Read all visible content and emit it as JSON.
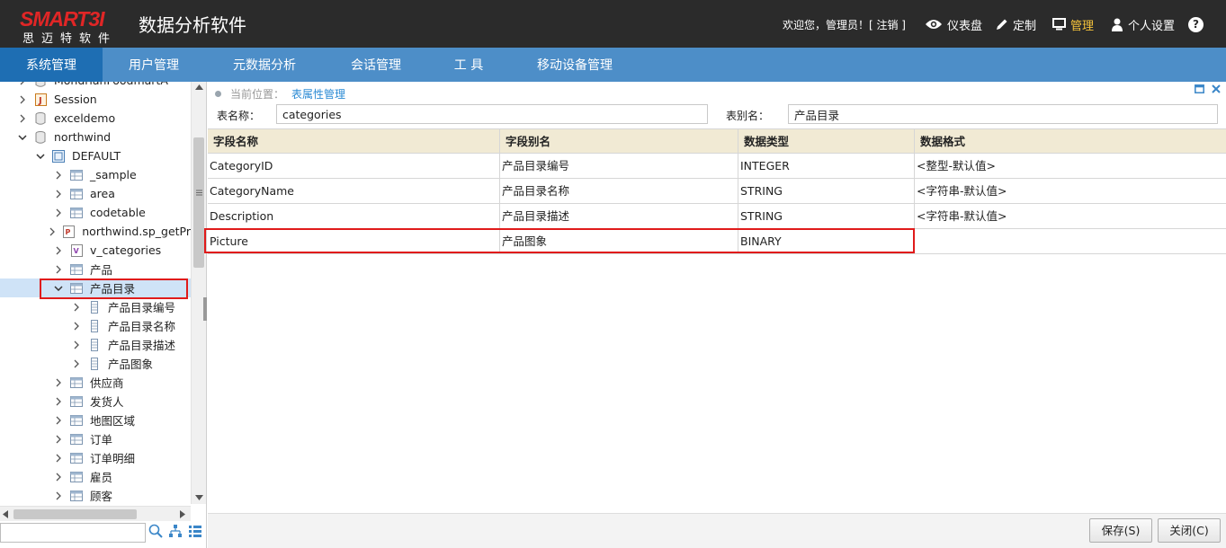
{
  "header": {
    "brand": "SMART3I",
    "brand_sub": "思迈特软件",
    "app_title": "数据分析软件",
    "welcome": "欢迎您，管理员！[ 注销 ]",
    "items": [
      {
        "label": "仪表盘",
        "icon": "eye-icon"
      },
      {
        "label": "定制",
        "icon": "pencil-icon"
      },
      {
        "label": "管理",
        "icon": "monitor-icon",
        "active": true
      },
      {
        "label": "个人设置",
        "icon": "user-icon"
      },
      {
        "label": "?",
        "icon": "help-icon"
      }
    ],
    "accent_color": "#f5c33b",
    "brand_color": "#e02626"
  },
  "nav": {
    "items": [
      "系统管理",
      "用户管理",
      "元数据分析",
      "会话管理",
      "工 具",
      "移动设备管理"
    ],
    "active_index": 0
  },
  "tree": {
    "rows": [
      {
        "label": "MondrianFoodmartA",
        "icon": "db-icon",
        "expanded": false
      },
      {
        "label": "Session",
        "icon": "java-icon",
        "expanded": false
      },
      {
        "label": "exceldemo",
        "icon": "db-icon",
        "expanded": false
      },
      {
        "label": "northwind",
        "icon": "db-icon",
        "expanded": true
      },
      {
        "label": "DEFAULT",
        "icon": "schema-icon",
        "expanded": true
      },
      {
        "label": "_sample",
        "icon": "table-icon",
        "expanded": false
      },
      {
        "label": "area",
        "icon": "table-icon",
        "expanded": false
      },
      {
        "label": "codetable",
        "icon": "table-icon",
        "expanded": false
      },
      {
        "label": "northwind.sp_getPr",
        "icon": "procedure-icon",
        "expanded": false
      },
      {
        "label": "v_categories",
        "icon": "view-icon",
        "expanded": false
      },
      {
        "label": "产品",
        "icon": "table-icon",
        "expanded": false
      },
      {
        "label": "产品目录",
        "icon": "table-icon",
        "expanded": true,
        "selected": true
      },
      {
        "label": "产品目录编号",
        "icon": "field-icon",
        "expanded": false
      },
      {
        "label": "产品目录名称",
        "icon": "field-icon",
        "expanded": false
      },
      {
        "label": "产品目录描述",
        "icon": "field-icon",
        "expanded": false
      },
      {
        "label": "产品图象",
        "icon": "field-icon",
        "expanded": false
      },
      {
        "label": "供应商",
        "icon": "table-icon",
        "expanded": false
      },
      {
        "label": "发货人",
        "icon": "table-icon",
        "expanded": false
      },
      {
        "label": "地图区域",
        "icon": "table-icon",
        "expanded": false
      },
      {
        "label": "订单",
        "icon": "table-icon",
        "expanded": false
      },
      {
        "label": "订单明细",
        "icon": "table-icon",
        "expanded": false
      },
      {
        "label": "雇员",
        "icon": "table-icon",
        "expanded": false
      },
      {
        "label": "顾客",
        "icon": "table-icon",
        "expanded": false
      }
    ],
    "search_placeholder": ""
  },
  "main": {
    "breadcrumb_label": "当前位置：",
    "breadcrumb_current": "表属性管理",
    "table_name_label": "表名称：",
    "table_name_value": "categories",
    "alias_label": "表别名：",
    "alias_value": "产品目录",
    "columns": [
      "字段名称",
      "字段别名",
      "数据类型",
      "数据格式"
    ],
    "rows": [
      [
        "CategoryID",
        "产品目录编号",
        "INTEGER",
        "<整型-默认值>"
      ],
      [
        "CategoryName",
        "产品目录名称",
        "STRING",
        "<字符串-默认值>"
      ],
      [
        "Description",
        "产品目录描述",
        "STRING",
        "<字符串-默认值>"
      ],
      [
        "Picture",
        "产品图象",
        "BINARY",
        ""
      ]
    ],
    "save_label": "保存(S)",
    "close_label": "关闭(C)"
  }
}
